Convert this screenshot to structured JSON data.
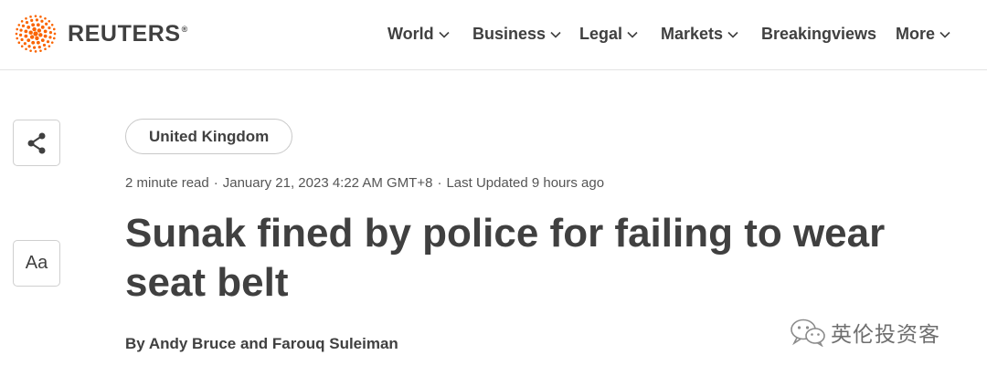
{
  "brand": {
    "name": "REUTERS",
    "registered": "®",
    "accent_color": "#fa6400"
  },
  "nav": {
    "items": [
      {
        "label": "World",
        "has_dropdown": true
      },
      {
        "label": "Business",
        "has_dropdown": true
      },
      {
        "label": "Legal",
        "has_dropdown": true
      },
      {
        "label": "Markets",
        "has_dropdown": true
      },
      {
        "label": "Breakingviews",
        "has_dropdown": false
      },
      {
        "label": "More",
        "has_dropdown": true
      }
    ]
  },
  "sidebar": {
    "share_icon": "share-icon",
    "font_size_label": "Aa"
  },
  "article": {
    "section_tag": "United Kingdom",
    "read_time": "2 minute read",
    "published": "January 21, 2023 4:22 AM GMT+8",
    "last_updated": "Last Updated 9 hours ago",
    "separator": "·",
    "headline": "Sunak fined by police for failing to wear seat belt",
    "byline": "By Andy Bruce and Farouq Suleiman"
  },
  "watermark": {
    "text": "英伦投资客",
    "icon": "wechat-icon"
  }
}
